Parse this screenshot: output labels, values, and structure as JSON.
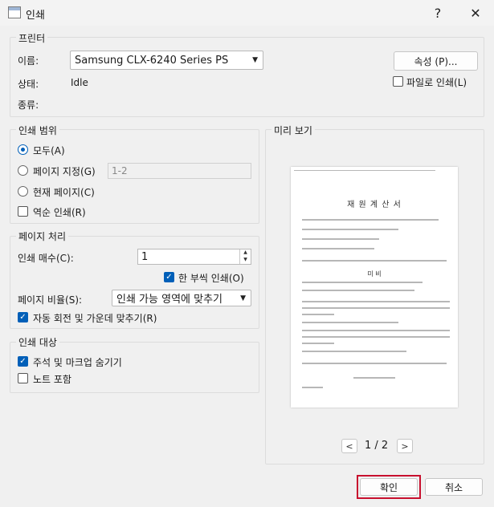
{
  "window": {
    "title": "인쇄",
    "help": "?",
    "close": "✕"
  },
  "printer": {
    "group": "프린터",
    "name_label": "이름:",
    "name_value": "Samsung CLX-6240 Series PS",
    "status_label": "상태:",
    "status_value": "Idle",
    "type_label": "종류:",
    "properties_button": "속성 (P)...",
    "print_to_file": "파일로 인쇄(L)",
    "print_to_file_checked": false
  },
  "range": {
    "group": "인쇄 범위",
    "all": "모두(A)",
    "pages": "페이지 지정(G)",
    "pages_value": "1-2",
    "current": "현재 페이지(C)",
    "reverse": "역순 인쇄(R)",
    "selected": "all"
  },
  "handling": {
    "group": "페이지 처리",
    "copies_label": "인쇄 매수(C):",
    "copies_value": "1",
    "collate": "한 부씩 인쇄(O)",
    "collate_checked": true,
    "scale_label": "페이지 비율(S):",
    "scale_value": "인쇄 가능 영역에 맞추기",
    "auto_rotate": "자동 회전 및 가운데 맞추기(R)",
    "auto_rotate_checked": true
  },
  "target": {
    "group": "인쇄 대상",
    "hide_annotations": "주석 및 마크업 숨기기",
    "hide_annotations_checked": true,
    "notes": "노트 포함",
    "notes_checked": false
  },
  "preview": {
    "group": "미리 보기",
    "doc_title": "재 원 계 산 서",
    "section_title": "미 비",
    "page_indicator": "1 / 2",
    "prev": "<",
    "next": ">"
  },
  "buttons": {
    "ok": "확인",
    "cancel": "취소"
  },
  "colors": {
    "accent": "#005fb8",
    "highlight": "#c8102e"
  }
}
